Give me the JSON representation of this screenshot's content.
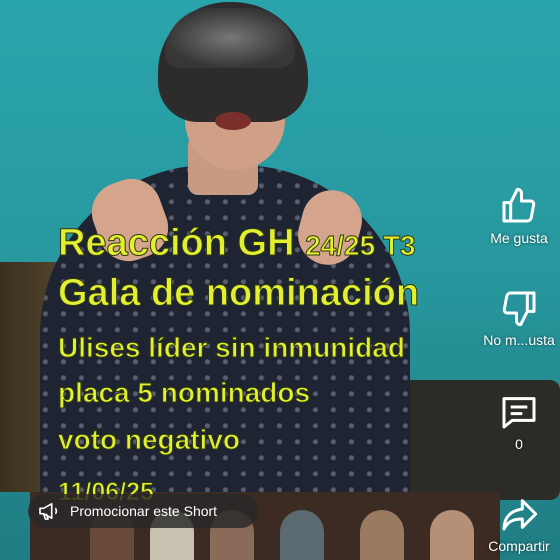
{
  "video": {
    "overlay_lines": {
      "line1_main": "Reacción GH",
      "line1_small": "24/25 T3",
      "line2": "Gala de nominación",
      "line3": "Ulises líder sin inmunidad",
      "line4": "placa 5 nominados",
      "line5": "voto negativo",
      "line6": "11/06/25"
    },
    "overlay_color": "#e3ef31"
  },
  "actions": {
    "like_label": "Me gusta",
    "dislike_label": "No m...usta",
    "comment_count": "0",
    "share_label": "Compartir"
  },
  "promo": {
    "label": "Promocionar este Short",
    "icon": "megaphone-icon"
  },
  "icons": [
    "thumbs-up-icon",
    "thumbs-down-icon",
    "comment-icon",
    "share-icon",
    "megaphone-icon"
  ]
}
